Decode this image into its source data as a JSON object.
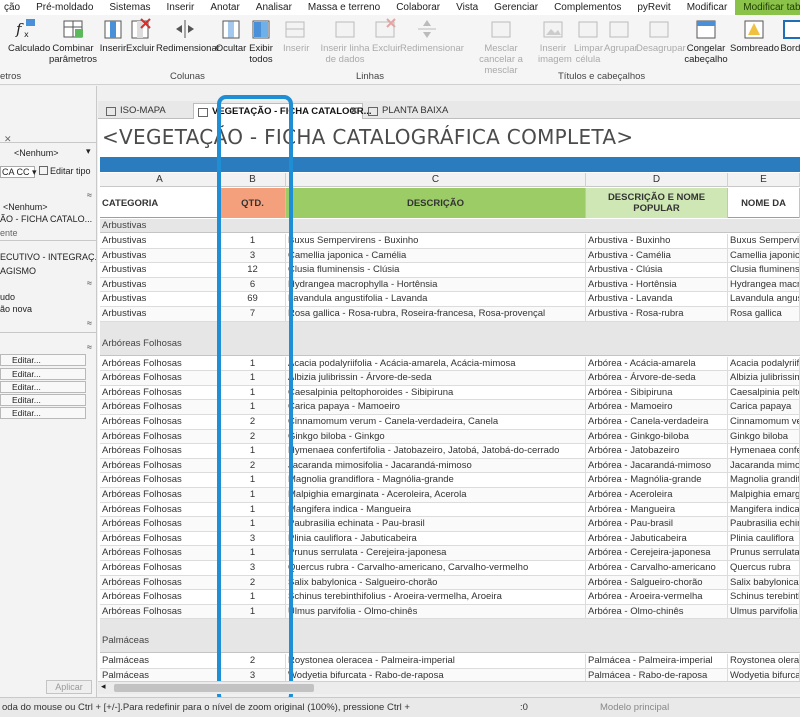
{
  "menubar": {
    "items": [
      "ção",
      "Pré-moldado",
      "Sistemas",
      "Inserir",
      "Anotar",
      "Analisar",
      "Massa e terreno",
      "Colaborar",
      "Vista",
      "Gerenciar",
      "Complementos",
      "pyRevit",
      "Modificar",
      "Modificar tabela/quantidades"
    ]
  },
  "ribbon": {
    "buttons": [
      "Calculado",
      "Combinar parâmetros",
      "Inserir",
      "Excluir",
      "Redimensionar",
      "Ocultar",
      "Exibir todos",
      "Inserir",
      "Inserir linha de dados",
      "Excluir",
      "Redimensionar",
      "Mesclar cancelar a mesclar",
      "Inserir imagem",
      "Limpar célula",
      "Agrupar",
      "Desagrupar",
      "Congelar cabeçalho",
      "Sombreado",
      "Borda"
    ],
    "group_labels": [
      "etros",
      "Colunas",
      "Linhas",
      "Títulos e cabeçalhos"
    ]
  },
  "left_panel": {
    "nenhum": "<Nenhum>",
    "type_value": "CA CC",
    "edit_type": "Editar tipo",
    "view_name": "ÃO - FICHA CATALO...",
    "label1": "ente",
    "item1": "ECUTIVO - INTEGRAÇ...",
    "item2": "AGISMO",
    "item3": "udo",
    "item4": "ão nova",
    "edit_label": "Editar...",
    "apply": "Aplicar"
  },
  "tabs": [
    {
      "label": "ISO-MAPA"
    },
    {
      "label": "VEGETAÇÃO - FICHA CATALOGR..."
    },
    {
      "label": "PLANTA BAIXA"
    }
  ],
  "schedule": {
    "title": "<VEGETAÇÃO - FICHA CATALOGRÁFICA COMPLETA>",
    "col_letters": [
      "A",
      "B",
      "C",
      "D",
      "E"
    ],
    "headers": [
      "CATEGORIA",
      "QTD.",
      "DESCRIÇÃO",
      "DESCRIÇÃO E NOME POPULAR",
      "NOME DA"
    ],
    "header_colors": {
      "qtd": "#f4a07c",
      "desc": "#9ccc65",
      "desc_pop": "#cfe7b4"
    },
    "groups": [
      {
        "name": "Arbustivas",
        "rows": [
          [
            "Arbustivas",
            "1",
            "Buxus Sempervirens - Buxinho",
            "Arbustiva - Buxinho",
            "Buxus Sempervire"
          ],
          [
            "Arbustivas",
            "3",
            "Camellia japonica - Camélia",
            "Arbustiva - Camélia",
            "Camellia japonica"
          ],
          [
            "Arbustivas",
            "12",
            "Clusia fluminensis - Clúsia",
            "Arbustiva - Clúsia",
            "Clusia fluminensi"
          ],
          [
            "Arbustivas",
            "6",
            "Hydrangea macrophylla - Hortênsia",
            "Arbustiva - Hortênsia",
            "Hydrangea macro"
          ],
          [
            "Arbustivas",
            "69",
            "Lavandula angustifolia - Lavanda",
            "Arbustiva - Lavanda",
            "Lavandula angust"
          ],
          [
            "Arbustivas",
            "7",
            "Rosa gallica - Rosa-rubra, Roseira-francesa, Rosa-provençal",
            "Arbustiva - Rosa-rubra",
            "Rosa gallica"
          ]
        ]
      },
      {
        "name": "Arbóreas Folhosas",
        "rows": [
          [
            "Arbóreas Folhosas",
            "1",
            "Acacia podalyriifolia - Acácia-amarela, Acácia-mimosa",
            "Arbórea - Acácia-amarela",
            "Acacia podalyriifo"
          ],
          [
            "Arbóreas Folhosas",
            "1",
            "Albizia julibrissin - Árvore-de-seda",
            "Arbórea - Árvore-de-seda",
            "Albizia julibrissin"
          ],
          [
            "Arbóreas Folhosas",
            "1",
            "Caesalpinia peltophoroides - Sibipiruna",
            "Arbórea - Sibipiruna",
            "Caesalpinia pelto"
          ],
          [
            "Arbóreas Folhosas",
            "1",
            "Carica papaya - Mamoeiro",
            "Arbórea - Mamoeiro",
            "Carica papaya"
          ],
          [
            "Arbóreas Folhosas",
            "2",
            "Cinnamomum verum - Canela-verdadeira, Canela",
            "Arbórea - Canela-verdadeira",
            "Cinnamomum veru"
          ],
          [
            "Arbóreas Folhosas",
            "2",
            "Ginkgo biloba - Ginkgo",
            "Arbórea - Ginkgo-biloba",
            "Ginkgo biloba"
          ],
          [
            "Arbóreas Folhosas",
            "1",
            "Hymenaea confertifolia - Jatobazeiro, Jatobá, Jatobá-do-cerrado",
            "Arbórea - Jatobazeiro",
            "Hymenaea confer"
          ],
          [
            "Arbóreas Folhosas",
            "2",
            "Jacaranda mimosifolia - Jacarandá-mimoso",
            "Arbórea - Jacarandá-mimoso",
            "Jacaranda mimos"
          ],
          [
            "Arbóreas Folhosas",
            "1",
            "Magnolia grandiflora - Magnólia-grande",
            "Arbórea - Magnólia-grande",
            "Magnolia grandifl"
          ],
          [
            "Arbóreas Folhosas",
            "1",
            "Malpighia emarginata - Aceroleira, Acerola",
            "Arbórea - Aceroleira",
            "Malpighia emargi"
          ],
          [
            "Arbóreas Folhosas",
            "1",
            "Mangifera indica - Mangueira",
            "Arbórea - Mangueira",
            "Mangifera indica"
          ],
          [
            "Arbóreas Folhosas",
            "1",
            "Paubrasilia echinata - Pau-brasil",
            "Arbórea - Pau-brasil",
            "Paubrasilia echin"
          ],
          [
            "Arbóreas Folhosas",
            "3",
            "Plinia cauliflora - Jabuticabeira",
            "Arbórea - Jabuticabeira",
            "Plinia cauliflora"
          ],
          [
            "Arbóreas Folhosas",
            "1",
            "Prunus serrulata - Cerejeira-japonesa",
            "Arbórea - Cerejeira-japonesa",
            "Prunus serrulata"
          ],
          [
            "Arbóreas Folhosas",
            "3",
            "Quercus rubra - Carvalho-americano, Carvalho-vermelho",
            "Arbórea - Carvalho-americano",
            "Quercus rubra"
          ],
          [
            "Arbóreas Folhosas",
            "2",
            "Salix babylonica - Salgueiro-chorão",
            "Arbórea - Salgueiro-chorão",
            "Salix babylonica"
          ],
          [
            "Arbóreas Folhosas",
            "1",
            "Schinus terebinthifolius - Aroeira-vermelha, Aroeira",
            "Arbórea - Aroeira-vermelha",
            "Schinus terebinth"
          ],
          [
            "Arbóreas Folhosas",
            "1",
            "Ulmus parvifolia - Olmo-chinês",
            "Arbórea - Olmo-chinês",
            "Ulmus parvifolia"
          ]
        ]
      },
      {
        "name": "Palmáceas",
        "rows": [
          [
            "Palmáceas",
            "2",
            "Roystonea oleracea - Palmeira-imperial",
            "Palmácea - Palmeira-imperial",
            "Roystonea olerac"
          ],
          [
            "Palmáceas",
            "3",
            "Wodyetia bifurcata - Rabo-de-raposa",
            "Palmácea - Rabo-de-raposa",
            "Wodyetia bifurca"
          ]
        ]
      }
    ]
  },
  "statusbar": {
    "text": "oda do mouse ou Ctrl + [+/-].Para redefinir para o nível de zoom original (100%), pressione Ctrl +",
    "count": ":0",
    "model": "Modelo principal"
  }
}
